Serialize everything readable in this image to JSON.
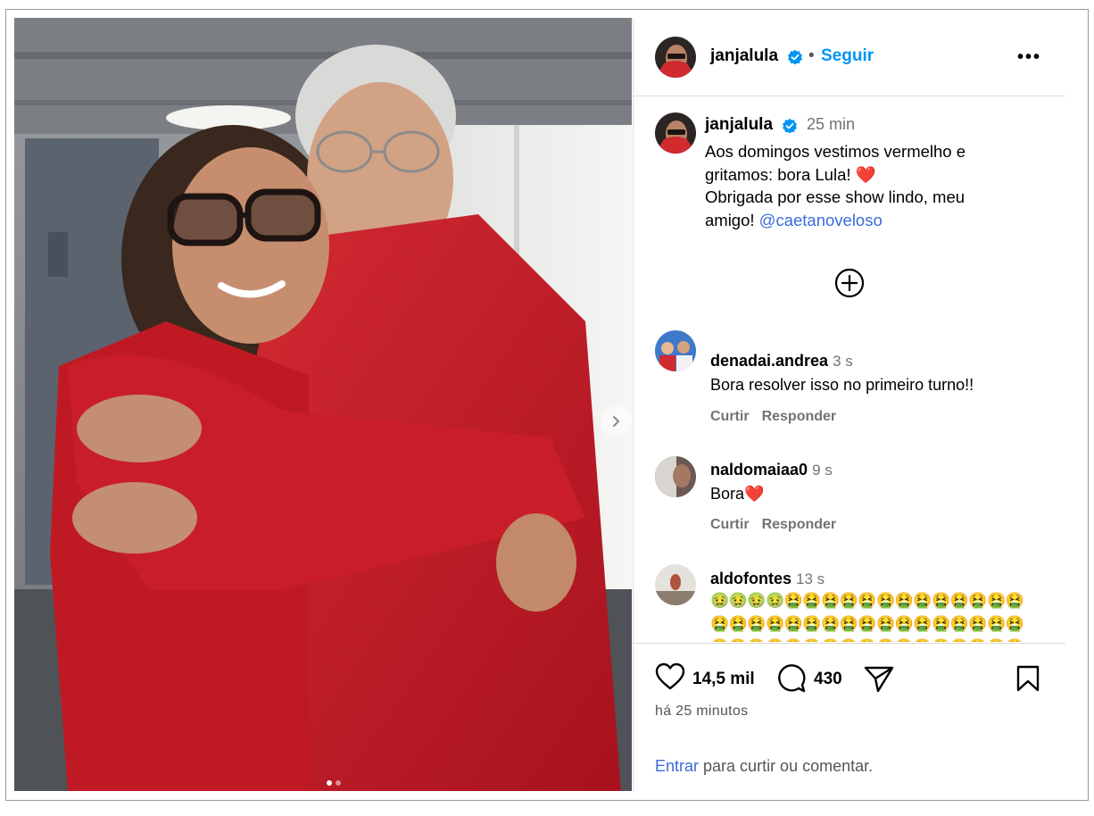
{
  "post": {
    "username": "janjalula",
    "follow_label": "Seguir",
    "separator": "•",
    "more_label": "•••",
    "caption_time": "25 min",
    "caption_lines": [
      "Aos domingos vestimos vermelho e",
      "gritamos: bora Lula! ❤️",
      "Obrigada por esse show lindo, meu",
      "amigo! "
    ],
    "caption_mention": "@caetanoveloso",
    "likes": "14,5 mil",
    "comments_count": "430",
    "posted_ago": "há 25 minutos",
    "login_link": "Entrar",
    "login_text": " para curtir ou comentar."
  },
  "carousel": {
    "total": 2,
    "current": 1
  },
  "comments": [
    {
      "user": "denadai.andrea",
      "time": "3 s",
      "text": "Bora resolver isso no primeiro turno!!",
      "like_label": "Curtir",
      "reply_label": "Responder"
    },
    {
      "user": "naldomaiaa0",
      "time": "9 s",
      "text": "Bora❤️",
      "like_label": "Curtir",
      "reply_label": "Responder"
    },
    {
      "user": "aldofontes",
      "time": "13 s",
      "text": "🤢🤢🤢🤢🤮🤮🤮🤮🤮🤮🤮🤮🤮🤮🤮🤮🤮🤮🤮🤮🤮🤮🤮🤮🤮🤮🤮🤮🤮🤮🤮🤮🤮🤮🤮🤮🤮🤮🤮🤮🤮🤮🤮🤮🤮🤮🤮🤮🤮🤮🤮🤮🤮🤮🤮🤮🤮🤮🤮🤮🤮🤮🤮🤮"
    }
  ],
  "colors": {
    "accent": "#0095f6",
    "verified": "#0095f6",
    "shirt": "#c81a26"
  }
}
